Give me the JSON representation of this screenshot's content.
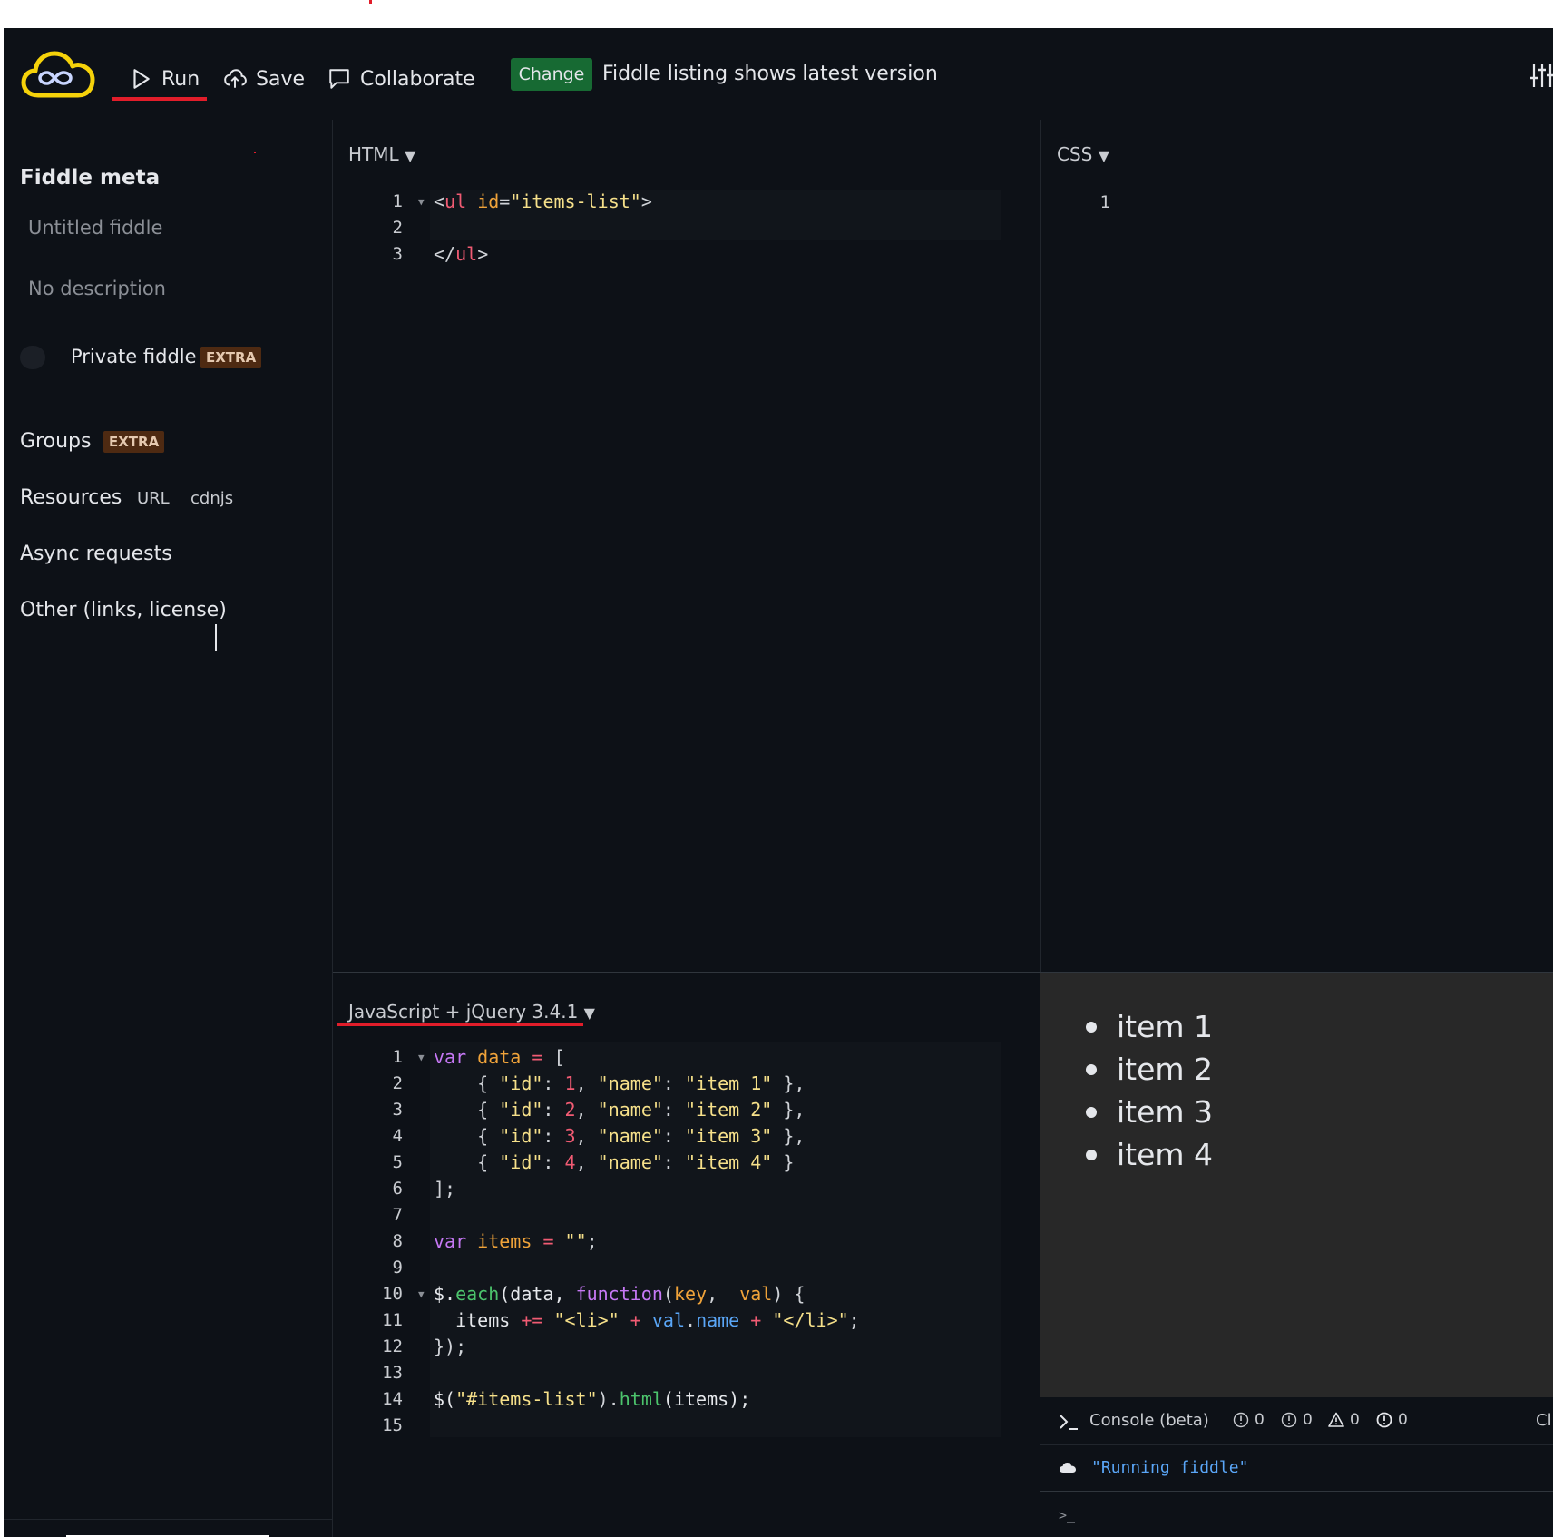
{
  "header": {
    "run_label": "Run",
    "save_label": "Save",
    "collaborate_label": "Collaborate",
    "change_badge": "Change",
    "listing_text": "Fiddle listing shows latest version"
  },
  "sidebar": {
    "title": "Fiddle meta",
    "title_placeholder": "Untitled fiddle",
    "description_placeholder": "No description",
    "private_label": "Private fiddle",
    "private_badge": "EXTRA",
    "groups_label": "Groups",
    "groups_badge": "EXTRA",
    "resources_label": "Resources",
    "resources_url": "URL",
    "resources_cdnjs": "cdnjs",
    "async_label": "Async requests",
    "other_label": "Other (links, license)"
  },
  "panels": {
    "html_label": "HTML",
    "css_label": "CSS",
    "js_label": "JavaScript + jQuery 3.4.1",
    "dropdown_glyph": "▼"
  },
  "html_code": {
    "line_numbers": [
      "1",
      "2",
      "3"
    ],
    "line1": {
      "open": "<",
      "tag": "ul",
      "attr": "id",
      "eq": "=",
      "value": "\"items-list\"",
      "close": ">"
    },
    "line3": {
      "open": "</",
      "tag": "ul",
      "close": ">"
    }
  },
  "css_code": {
    "line_numbers": [
      "1"
    ]
  },
  "js_code": {
    "line_numbers": [
      "1",
      "2",
      "3",
      "4",
      "5",
      "6",
      "7",
      "8",
      "9",
      "10",
      "11",
      "12",
      "13",
      "14",
      "15"
    ],
    "var_kw": "var",
    "data_name": "data",
    "eq": "=",
    "open_bracket": "[",
    "rows": [
      {
        "id": "1",
        "name": "\"item 1\"",
        "end": " },"
      },
      {
        "id": "2",
        "name": "\"item 2\"",
        "end": " },"
      },
      {
        "id": "3",
        "name": "\"item 3\"",
        "end": " },"
      },
      {
        "id": "4",
        "name": "\"item 4\"",
        "end": " }"
      }
    ],
    "id_key": "\"id\"",
    "name_key": "\"name\"",
    "close_bracket": "];",
    "items_name": "items",
    "empty_str": "\"\"",
    "semicolon": ";",
    "each_obj": "$.",
    "each_fn": "each",
    "each_args": "(data, ",
    "function_kw": "function",
    "key_param": "key",
    "val_param": "val",
    "line11_items": "items",
    "plus_eq": "+=",
    "li_open": "\"<li>\"",
    "plus": "+",
    "val_obj": "val",
    "name_prop": "name",
    "li_close": "\"</li>\"",
    "close_fn": "});",
    "selector_call": "$(",
    "selector_str": "\"#items-list\"",
    "html_method": "html",
    "html_args": "(items);"
  },
  "result": {
    "items": [
      "item 1",
      "item 2",
      "item 3",
      "item 4"
    ]
  },
  "console": {
    "label": "Console (beta)",
    "counts": [
      "0",
      "0",
      "0",
      "0"
    ],
    "message": "\"Running fiddle\"",
    "prompt": ">_",
    "cut_text": "Cl"
  },
  "colors": {
    "background": "#0d1117",
    "accent_red": "#e11d2a",
    "change_green": "#176a33",
    "logo_yellow": "#f5d20a",
    "extra_badge": "#4e2a12",
    "result_bg": "#282828"
  },
  "icons": [
    "jsfiddle-logo-icon",
    "play-icon",
    "cloud-upload-icon",
    "chat-bubble-icon",
    "settings-sliders-icon",
    "terminal-icon",
    "info-icon",
    "warning-icon",
    "cloud-icon"
  ]
}
